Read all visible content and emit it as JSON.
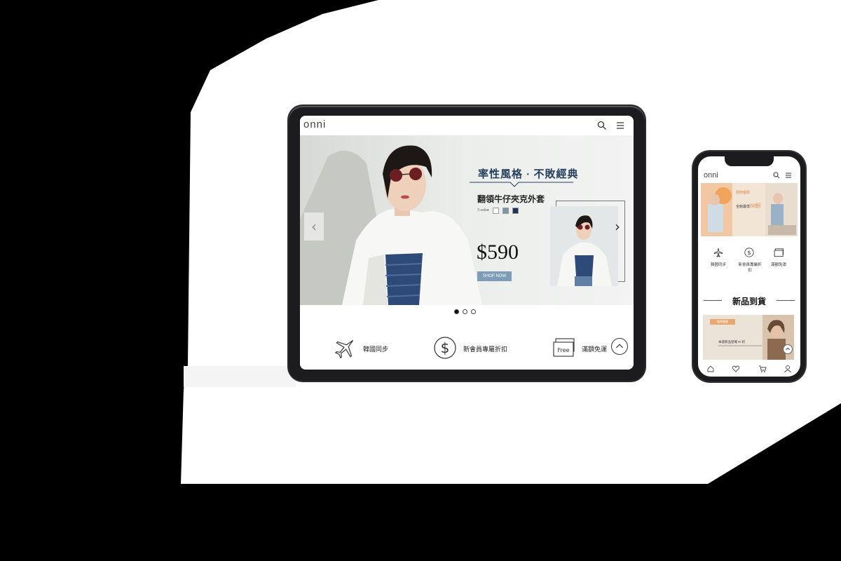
{
  "tablet": {
    "logo": "onni",
    "header_icons": [
      "search-icon",
      "menu-icon"
    ],
    "hero": {
      "headline": "率性風格 · 不敗經典",
      "product_name": "翻領牛仔夾克外套",
      "colors_label": "3 color",
      "color_swatches": [
        "#ffffff",
        "#7f95a6",
        "#1d3358"
      ],
      "price": "$590",
      "cta": "SHOP NOW"
    },
    "carousel": {
      "slides": 3,
      "active_index": 0
    },
    "features": [
      {
        "icon": "airplane-icon",
        "label": "韓國同步"
      },
      {
        "icon": "dollar-coin-icon",
        "label": "新會員專屬折扣"
      },
      {
        "icon": "free-shipping-icon",
        "label": "滿額免運"
      }
    ]
  },
  "phone": {
    "logo": "onni",
    "banner": {
      "line1": "限時優惠",
      "line2": "全館最低",
      "line3": "88折"
    },
    "features": [
      {
        "icon": "airplane-icon",
        "label": "韓國同步"
      },
      {
        "icon": "dollar-coin-icon",
        "label": "新會員專屬折扣"
      },
      {
        "icon": "free-shipping-icon",
        "label": "滿額免運"
      }
    ],
    "section_title": "新品到貨",
    "promo": {
      "tag": "限時優惠",
      "text": "本週新品登場 95 折"
    },
    "tabbar": [
      "home-icon",
      "heart-icon",
      "cart-icon",
      "user-icon"
    ]
  },
  "colors": {
    "navy": "#27405e",
    "button_blue": "#7d9cb8",
    "peach": "#e8a870"
  }
}
